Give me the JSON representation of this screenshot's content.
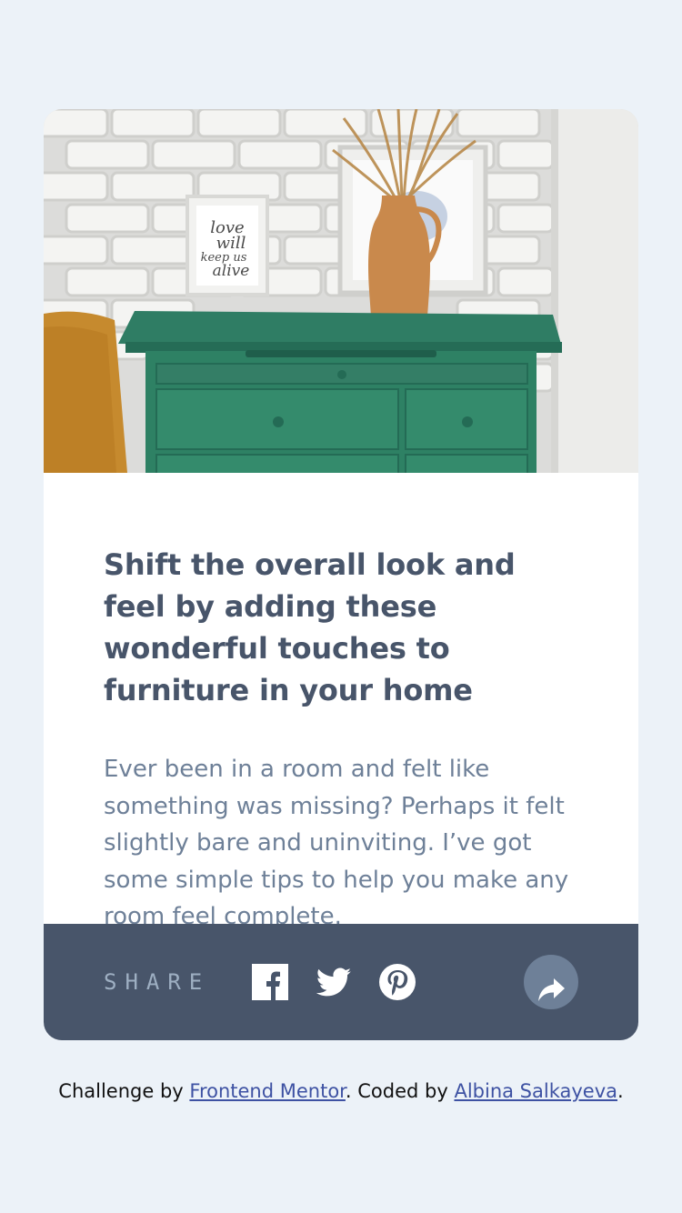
{
  "card": {
    "image_alt": "Green wooden drawer with a vase and picture frames",
    "frame_text": [
      "love",
      "will",
      "keep us",
      "alive"
    ],
    "title": "Shift the overall look and feel by adding these wonderful touches to furniture in your home",
    "body": "Ever been in a room and felt like something was missing? Perhaps it felt slightly bare and uninviting. I’ve got some simple tips to help you make any room feel complete."
  },
  "share": {
    "label": "SHARE",
    "icons": [
      "facebook-icon",
      "twitter-icon",
      "pinterest-icon",
      "share-icon"
    ]
  },
  "attribution": {
    "prefix": "Challenge by ",
    "link1": "Frontend Mentor",
    "middle": ". Coded by ",
    "link2": "Albina Salkayeva",
    "suffix": "."
  },
  "colors": {
    "page_background": "#ecf2f8",
    "title": "#48556a",
    "body": "#6e8098",
    "share_bar": "#48556a",
    "share_label": "#9eafc2",
    "share_button": "#6e8098",
    "link": "#3e52a3"
  }
}
